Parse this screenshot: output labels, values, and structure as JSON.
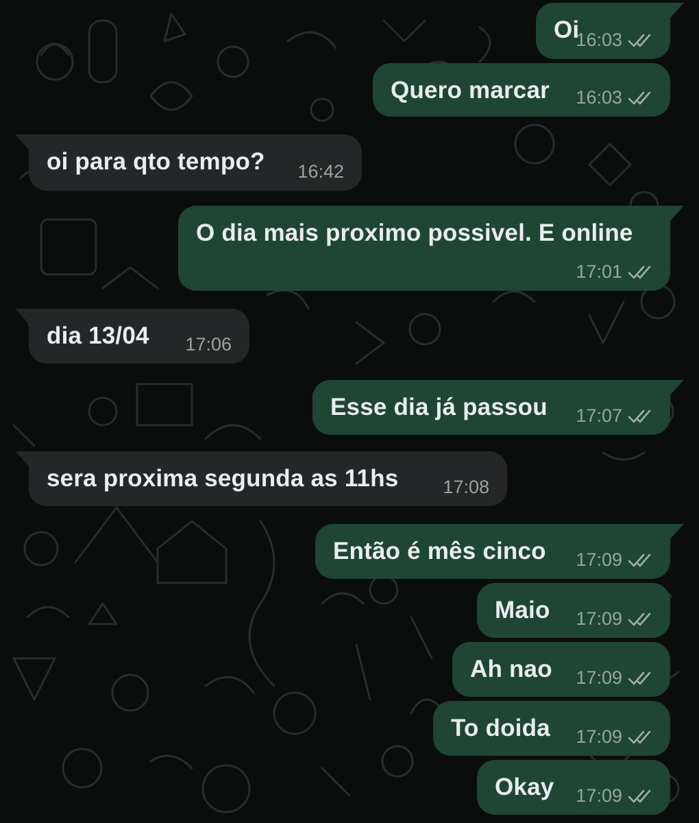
{
  "messages": [
    {
      "text": "Oi",
      "time": "16:03",
      "direction": "outgoing",
      "status": "read-ticks-icon"
    },
    {
      "text": "Quero marcar",
      "time": "16:03",
      "direction": "outgoing",
      "status": "read-ticks-icon"
    },
    {
      "text": "oi para qto tempo?",
      "time": "16:42",
      "direction": "incoming"
    },
    {
      "text": "O dia mais proximo possivel. E online",
      "time": "17:01",
      "direction": "outgoing",
      "status": "read-ticks-icon"
    },
    {
      "text": "dia 13/04",
      "time": "17:06",
      "direction": "incoming"
    },
    {
      "text": "Esse dia já passou",
      "time": "17:07",
      "direction": "outgoing",
      "status": "read-ticks-icon"
    },
    {
      "text": "sera proxima segunda as 11hs",
      "time": "17:08",
      "direction": "incoming"
    },
    {
      "text": "Então é mês cinco",
      "time": "17:09",
      "direction": "outgoing",
      "status": "read-ticks-icon"
    },
    {
      "text": "Maio",
      "time": "17:09",
      "direction": "outgoing",
      "status": "read-ticks-icon"
    },
    {
      "text": "Ah nao",
      "time": "17:09",
      "direction": "outgoing",
      "status": "read-ticks-icon"
    },
    {
      "text": "To doida",
      "time": "17:09",
      "direction": "outgoing",
      "status": "read-ticks-icon"
    },
    {
      "text": "Okay",
      "time": "17:09",
      "direction": "outgoing",
      "status": "read-ticks-icon"
    }
  ],
  "colors": {
    "background": "#0b0c0c",
    "outgoing_bubble": "#1f4534",
    "incoming_bubble": "#242628",
    "text": "#e9edef",
    "meta": "#9aa5a0"
  }
}
